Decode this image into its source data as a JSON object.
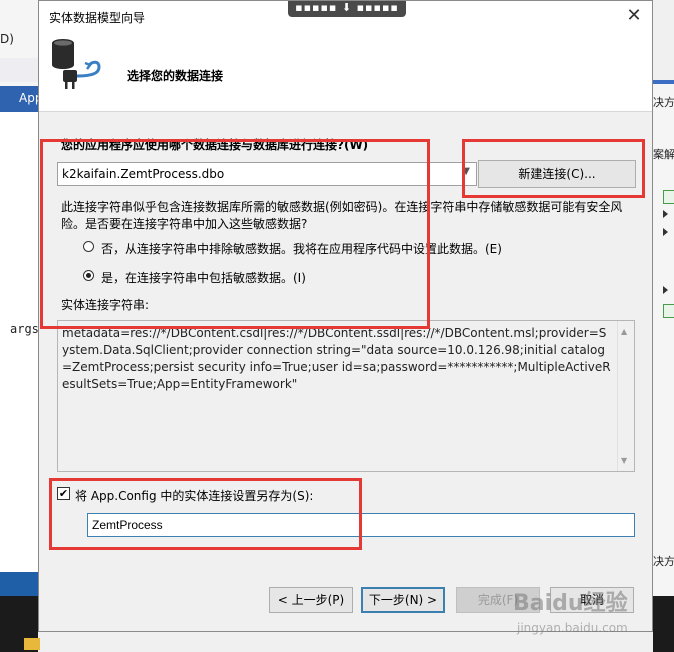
{
  "background": {
    "menu_fragment": "D)",
    "tab_fragment": "App",
    "code_fragment": "args",
    "right_fragment_1": "决方",
    "right_fragment_2": "案解",
    "right_fragment_3": "决方"
  },
  "dialog": {
    "title": "实体数据模型向导",
    "close_glyph": "✕",
    "grip_text": "▪▪▪▪▪ ⬇ ▪▪▪▪▪",
    "header": "选择您的数据连接",
    "question": "您的应用程序应使用哪个数据连接与数据库进行连接?(W)",
    "connection": {
      "selected": "k2kaifain.ZemtProcess.dbo",
      "new_button": "新建连接(C)..."
    },
    "warning": "此连接字符串似乎包含连接数据库所需的敏感数据(例如密码)。在连接字符串中存储敏感数据可能有安全风险。是否要在连接字符串中加入这些敏感数据?",
    "radio_no": "否，从连接字符串中排除敏感数据。我将在应用程序代码中设置此数据。(E)",
    "radio_yes": "是，在连接字符串中包括敏感数据。(I)",
    "entity_label": "实体连接字符串:",
    "entity_connection_string": "metadata=res://*/DBContent.csdl|res://*/DBContent.ssdl|res://*/DBContent.msl;provider=System.Data.SqlClient;provider connection string=\"data source=10.0.126.98;initial catalog=ZemtProcess;persist security info=True;user id=sa;password=***********;MultipleActiveResultSets=True;App=EntityFramework\"",
    "save_checkbox_label": "将 App.Config 中的实体连接设置另存为(S):",
    "save_checked": true,
    "save_name": "ZemtProcess",
    "buttons": {
      "prev": "< 上一步(P)",
      "next": "下一步(N) >",
      "finish": "完成(F)",
      "cancel": "取消"
    }
  },
  "watermark": {
    "brand": "Baidu经验",
    "url": "jingyan.baidu.com"
  },
  "colors": {
    "annotation_red": "#e53935",
    "focus_blue": "#3c7fb1"
  }
}
